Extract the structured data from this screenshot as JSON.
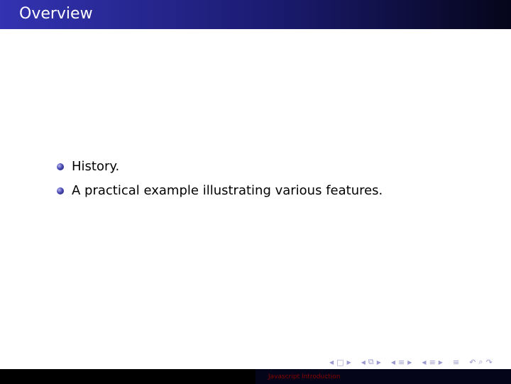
{
  "frame": {
    "title": "Overview"
  },
  "bullets": [
    {
      "text": "History."
    },
    {
      "text": "A practical example illustrating various features."
    }
  ],
  "footer": {
    "short_title": "Javascript Introduction"
  },
  "navigation": {
    "icons": [
      "nav-prev-slide-icon",
      "nav-slide-icon",
      "nav-next-slide-icon",
      "nav-prev-frame-icon",
      "nav-frame-icon",
      "nav-next-frame-icon",
      "nav-prev-subsection-icon",
      "nav-subsection-icon",
      "nav-next-subsection-icon",
      "nav-prev-section-icon",
      "nav-section-icon",
      "nav-next-section-icon",
      "nav-appendix-icon",
      "nav-search-icon",
      "nav-back-icon",
      "nav-forward-icon"
    ]
  },
  "colors": {
    "title_bar_start": "#3333b2",
    "title_bar_end": "#05051a",
    "footer_text": "#8b0000",
    "nav_icons": "#9a9ad0"
  }
}
